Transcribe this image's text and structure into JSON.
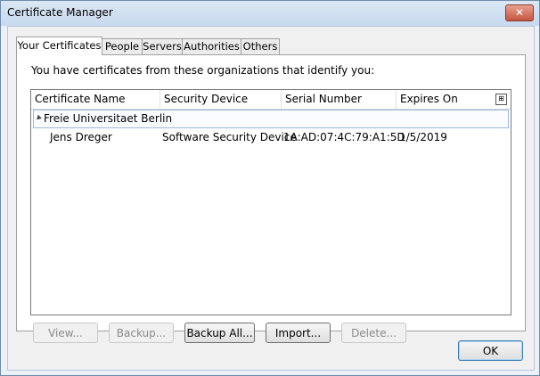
{
  "window": {
    "title": "Certificate Manager",
    "close_glyph": "✕"
  },
  "tabs": [
    {
      "label": "Your Certificates",
      "active": true
    },
    {
      "label": "People"
    },
    {
      "label": "Servers"
    },
    {
      "label": "Authorities"
    },
    {
      "label": "Others"
    }
  ],
  "panel": {
    "intro": "You have certificates from these organizations that identify you:",
    "columns": [
      "Certificate Name",
      "Security Device",
      "Serial Number",
      "Expires On"
    ],
    "column_picker_icon": "column-picker-icon",
    "groups": [
      {
        "name": "Freie Universitaet Berlin",
        "expanded": true,
        "certs": [
          {
            "name": "Jens Dreger",
            "device": "Software Security Device",
            "serial": "1A:AD:07:4C:79:A1:5D",
            "expires": "1/5/2019"
          }
        ]
      }
    ]
  },
  "buttons": {
    "view": "View...",
    "backup": "Backup...",
    "backup_all": "Backup All...",
    "import": "Import...",
    "delete": "Delete...",
    "ok": "OK"
  }
}
